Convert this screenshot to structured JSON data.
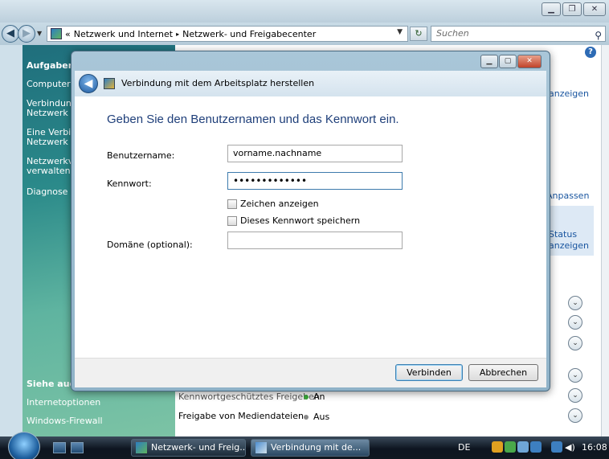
{
  "explorer": {
    "address_prefix": "«",
    "breadcrumb_1": "Netzwerk und Internet",
    "breadcrumb_sep": "▸",
    "breadcrumb_2": "Netzwerk- und Freigabecenter",
    "search_placeholder": "Suchen",
    "tasks_heading": "Aufgaben",
    "tasks": [
      "Computer",
      "Verbindung",
      "Netzwerk h",
      "Eine Verbin",
      "Netzwerk e",
      "Netzwerkve",
      "verwalten",
      "Diagnose u"
    ],
    "see_also_heading": "Siehe auch",
    "see_also": [
      "Internetoptionen",
      "Windows-Firewall"
    ],
    "right_links": [
      "anzeigen",
      "Anpassen",
      "Status",
      "anzeigen"
    ],
    "sharing_row_cut": "Kennwortgeschütztes Freigeben",
    "sharing_state_on": "An",
    "media_sharing_label": "Freigabe von Mediendateien",
    "media_sharing_state": "Aus"
  },
  "dialog": {
    "title": "Verbindung mit dem Arbeitsplatz herstellen",
    "heading": "Geben Sie den Benutzernamen und das Kennwort ein.",
    "username_label": "Benutzername:",
    "username_value": "vorname.nachname",
    "password_label": "Kennwort:",
    "password_value": "•••••••••••••",
    "show_chars_label": "Zeichen anzeigen",
    "save_password_label": "Dieses Kennwort speichern",
    "domain_label": "Domäne (optional):",
    "domain_value": "",
    "connect_button": "Verbinden",
    "cancel_button": "Abbrechen"
  },
  "taskbar": {
    "task_1": "Netzwerk- und Freig...",
    "task_2": "Verbindung mit de...",
    "language": "DE",
    "clock": "16:08"
  }
}
